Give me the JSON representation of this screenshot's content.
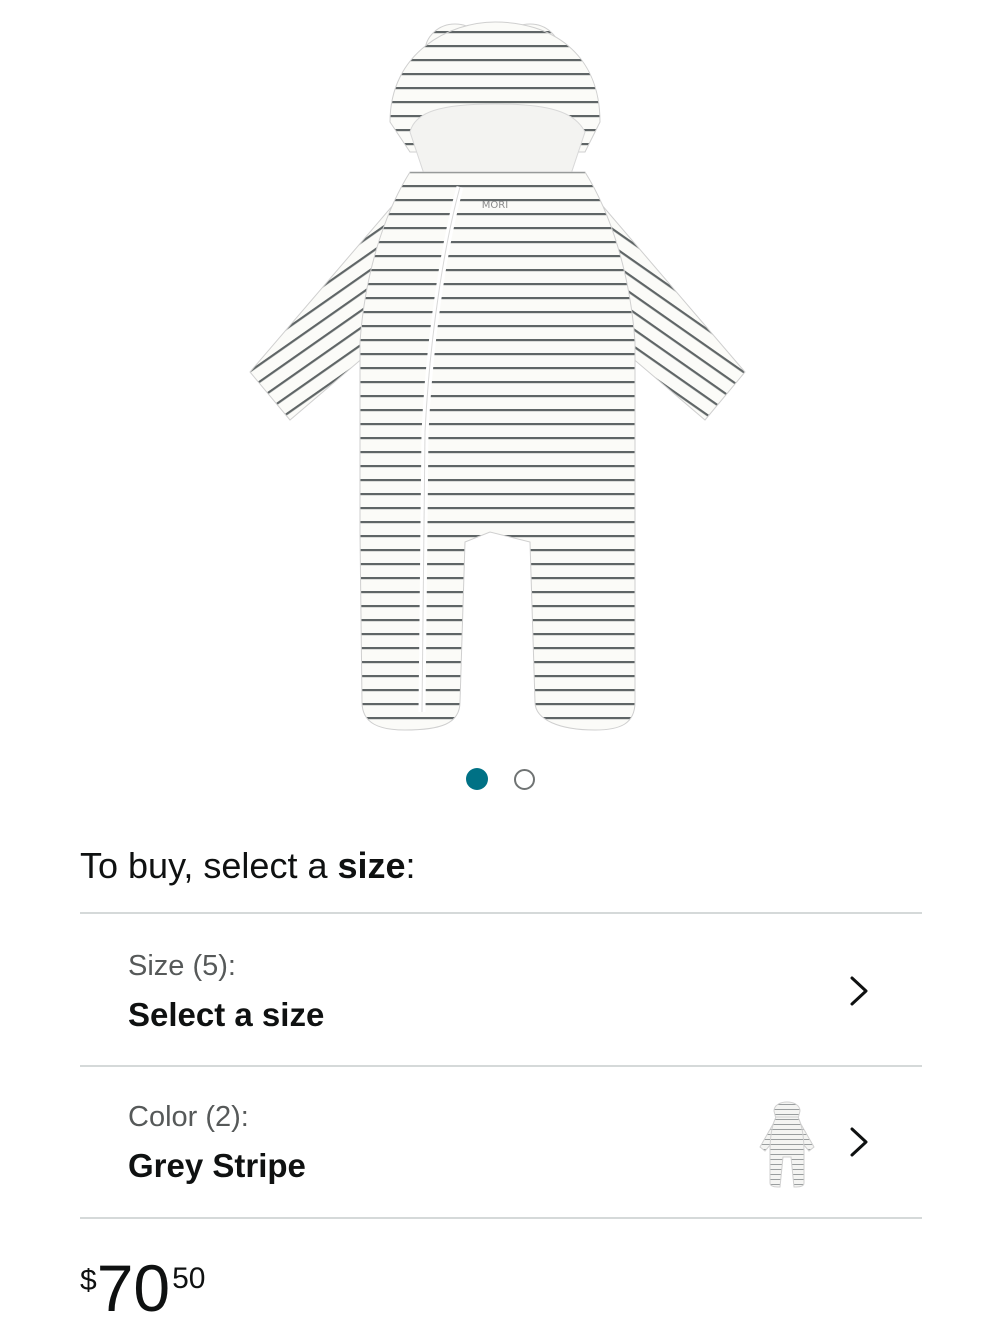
{
  "product": {
    "brand_tag": "MORI"
  },
  "gallery": {
    "image_count": 2,
    "active_index": 0
  },
  "prompt": {
    "prefix": "To buy, select a ",
    "emphasis": "size",
    "suffix": ":"
  },
  "variations": {
    "size": {
      "label": "Size (5):",
      "value": "Select a size"
    },
    "color": {
      "label": "Color (2):",
      "value": "Grey Stripe"
    }
  },
  "price": {
    "symbol": "$",
    "whole": "70",
    "fraction": "50"
  },
  "colors": {
    "accent": "#007185",
    "divider": "#d5d9d9",
    "stripe": "#5f6566",
    "fabric": "#fbfbf8"
  }
}
